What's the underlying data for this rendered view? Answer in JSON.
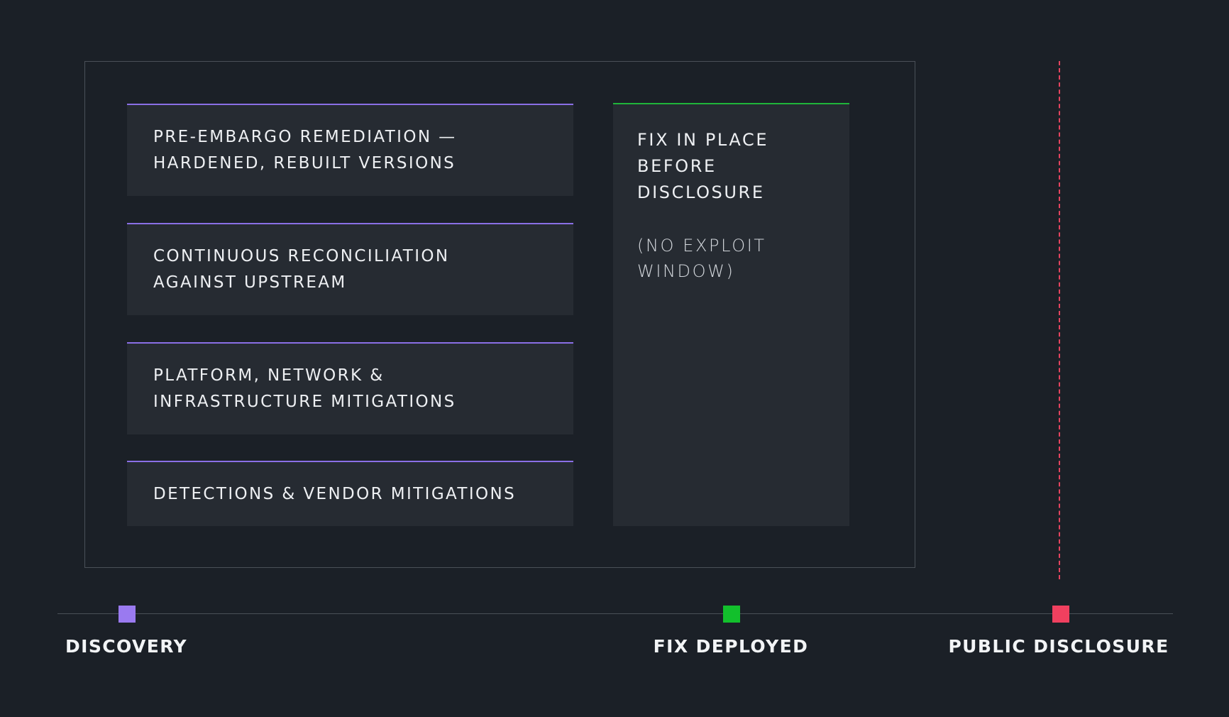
{
  "steps": [
    {
      "line1": "PRE-EMBARGO REMEDIATION —",
      "line2": "HARDENED, REBUILT VERSIONS"
    },
    {
      "line1": "CONTINUOUS RECONCILIATION",
      "line2": "AGAINST UPSTREAM"
    },
    {
      "line1": "PLATFORM, NETWORK &",
      "line2": "INFRASTRUCTURE MITIGATIONS"
    },
    {
      "line1": "DETECTIONS & VENDOR MITIGATIONS"
    }
  ],
  "fix_box": {
    "title_lines": [
      "FIX IN PLACE",
      "BEFORE",
      "DISCLOSURE"
    ],
    "note_lines": [
      "(NO EXPLOIT",
      "WINDOW)"
    ]
  },
  "milestones": [
    {
      "label": "DISCOVERY",
      "color": "#9a7af0"
    },
    {
      "label": "FIX DEPLOYED",
      "color": "#12c02c"
    },
    {
      "label": "PUBLIC DISCLOSURE",
      "color": "#f0405f"
    }
  ],
  "colors": {
    "background": "#1b2027",
    "step_accent": "#8a6fe6",
    "fix_accent": "#1fb53a",
    "disclosure_line": "#e5445f"
  }
}
